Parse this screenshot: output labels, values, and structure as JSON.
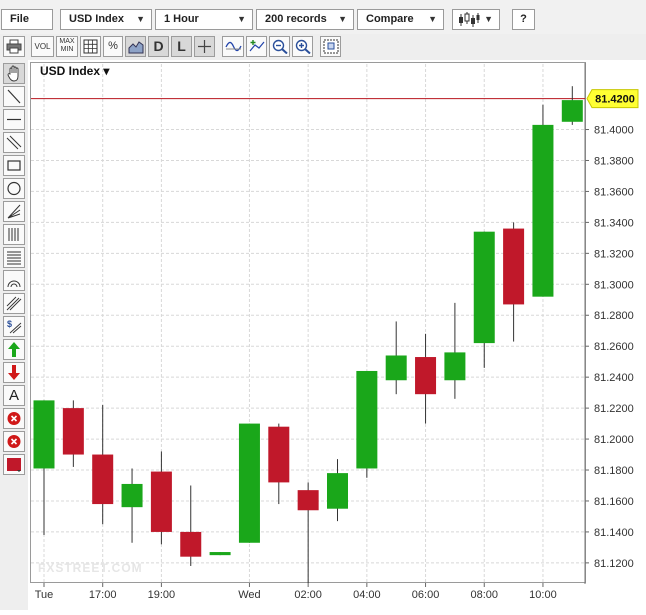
{
  "toolbar": {
    "file_label": "File",
    "symbol_label": "USD Index",
    "interval_label": "1 Hour",
    "records_label": "200 records",
    "compare_label": "Compare",
    "chart_type_icon": "candlestick-icon",
    "help_label": "?"
  },
  "tools": {
    "vol_label": "VOL",
    "maxmin_label": "MAX MIN",
    "pct_label": "%",
    "d_label": "D",
    "l_label": "L",
    "text_label": "A"
  },
  "colors": {
    "up": "#1aa71a",
    "down": "#c0182a",
    "last_price_line": "#b8141e",
    "last_price_badge": "#ffff33",
    "grid": "#d8d8d8",
    "plot_border": "#9a9a9a"
  },
  "chart_data": {
    "type": "candlestick",
    "title": "USD Index ▾",
    "last_price": 81.42,
    "last_price_label": "81.4200",
    "y_ticks": [
      "81.4000",
      "81.3800",
      "81.3600",
      "81.3400",
      "81.3200",
      "81.3000",
      "81.2800",
      "81.2600",
      "81.2400",
      "81.2200",
      "81.2000",
      "81.1800",
      "81.1600",
      "81.1400",
      "81.1200"
    ],
    "ylim": [
      81.107,
      81.432
    ],
    "grid": true,
    "x_ticks": [
      {
        "label": "Tue",
        "index": 0
      },
      {
        "label": "17:00",
        "index": 2
      },
      {
        "label": "19:00",
        "index": 4
      },
      {
        "label": "Wed",
        "index": 7
      },
      {
        "label": "02:00",
        "index": 9
      },
      {
        "label": "04:00",
        "index": 11
      },
      {
        "label": "06:00",
        "index": 13
      },
      {
        "label": "08:00",
        "index": 15
      },
      {
        "label": "10:00",
        "index": 17
      }
    ],
    "candles": [
      {
        "open": 81.181,
        "high": 81.225,
        "low": 81.138,
        "close": 81.225
      },
      {
        "open": 81.22,
        "high": 81.225,
        "low": 81.182,
        "close": 81.19
      },
      {
        "open": 81.19,
        "high": 81.222,
        "low": 81.145,
        "close": 81.158
      },
      {
        "open": 81.156,
        "high": 81.181,
        "low": 81.133,
        "close": 81.171
      },
      {
        "open": 81.179,
        "high": 81.192,
        "low": 81.132,
        "close": 81.14
      },
      {
        "open": 81.14,
        "high": 81.17,
        "low": 81.118,
        "close": 81.124
      },
      {
        "open": 81.125,
        "high": 81.127,
        "low": 81.125,
        "close": 81.127
      },
      {
        "open": 81.133,
        "high": 81.21,
        "low": 81.133,
        "close": 81.21
      },
      {
        "open": 81.208,
        "high": 81.21,
        "low": 81.158,
        "close": 81.172
      },
      {
        "open": 81.167,
        "high": 81.172,
        "low": 81.107,
        "close": 81.154
      },
      {
        "open": 81.155,
        "high": 81.187,
        "low": 81.147,
        "close": 81.178
      },
      {
        "open": 81.181,
        "high": 81.244,
        "low": 81.175,
        "close": 81.244
      },
      {
        "open": 81.238,
        "high": 81.276,
        "low": 81.229,
        "close": 81.254
      },
      {
        "open": 81.253,
        "high": 81.268,
        "low": 81.21,
        "close": 81.229
      },
      {
        "open": 81.238,
        "high": 81.288,
        "low": 81.226,
        "close": 81.256
      },
      {
        "open": 81.262,
        "high": 81.334,
        "low": 81.246,
        "close": 81.334
      },
      {
        "open": 81.336,
        "high": 81.34,
        "low": 81.263,
        "close": 81.287
      },
      {
        "open": 81.292,
        "high": 81.416,
        "low": 81.292,
        "close": 81.403
      },
      {
        "open": 81.405,
        "high": 81.428,
        "low": 81.403,
        "close": 81.419
      }
    ]
  },
  "watermark": "FXSTREET.COM"
}
